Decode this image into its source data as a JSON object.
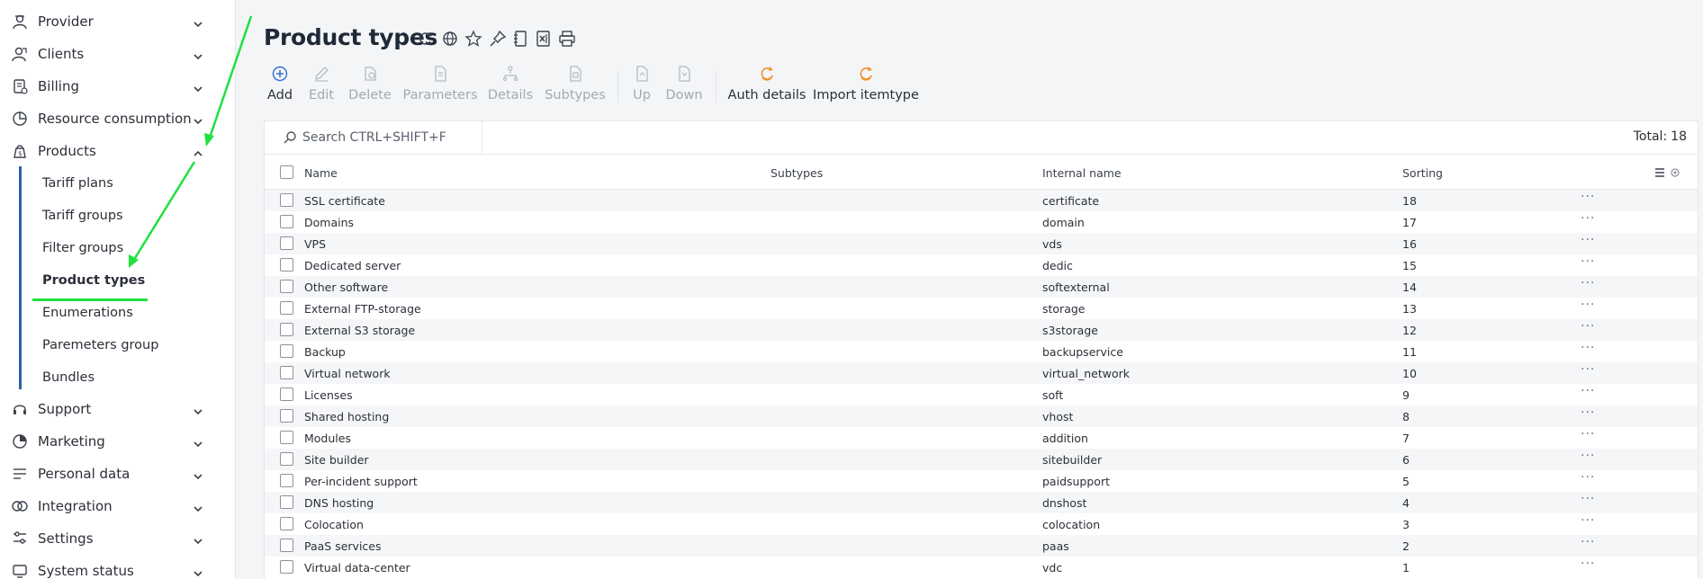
{
  "sidebar": {
    "items": [
      {
        "label": "Provider",
        "icon": "provider-icon",
        "expanded": false
      },
      {
        "label": "Clients",
        "icon": "clients-icon",
        "expanded": false
      },
      {
        "label": "Billing",
        "icon": "billing-icon",
        "expanded": false
      },
      {
        "label": "Resource consumption",
        "icon": "resource-consumption-icon",
        "expanded": false
      },
      {
        "label": "Products",
        "icon": "products-icon",
        "expanded": true
      },
      {
        "label": "Support",
        "icon": "support-icon",
        "expanded": false
      },
      {
        "label": "Marketing",
        "icon": "marketing-icon",
        "expanded": false
      },
      {
        "label": "Personal data",
        "icon": "personal-data-icon",
        "expanded": false
      },
      {
        "label": "Integration",
        "icon": "integration-icon",
        "expanded": false
      },
      {
        "label": "Settings",
        "icon": "settings-icon",
        "expanded": false
      },
      {
        "label": "System status",
        "icon": "system-status-icon",
        "expanded": false
      }
    ],
    "products_subitems": [
      {
        "label": "Tariff plans",
        "active": false
      },
      {
        "label": "Tariff groups",
        "active": false
      },
      {
        "label": "Filter groups",
        "active": false
      },
      {
        "label": "Product types",
        "active": true
      },
      {
        "label": "Enumerations",
        "active": false
      },
      {
        "label": "Paremeters group",
        "active": false
      },
      {
        "label": "Bundles",
        "active": false
      }
    ]
  },
  "page": {
    "title": "Product types",
    "title_icons": [
      "refresh-icon",
      "globe-icon",
      "star-icon",
      "pin-icon",
      "notebook-icon",
      "excel-export-icon",
      "print-icon"
    ]
  },
  "toolbar": {
    "buttons": [
      {
        "label": "Add",
        "icon": "add-icon",
        "enabled": true
      },
      {
        "label": "Edit",
        "icon": "edit-icon",
        "enabled": false
      },
      {
        "label": "Delete",
        "icon": "delete-icon",
        "enabled": false
      },
      {
        "label": "Parameters",
        "icon": "parameters-icon",
        "enabled": false
      },
      {
        "label": "Details",
        "icon": "details-icon",
        "enabled": false
      },
      {
        "label": "Subtypes",
        "icon": "subtypes-icon",
        "enabled": false
      },
      {
        "label": "Up",
        "icon": "up-icon",
        "enabled": false
      },
      {
        "label": "Down",
        "icon": "down-icon",
        "enabled": false
      },
      {
        "label": "Auth details",
        "icon": "auth-details-icon",
        "enabled": true
      },
      {
        "label": "Import itemtype",
        "icon": "import-itemtype-icon",
        "enabled": true
      }
    ]
  },
  "search": {
    "placeholder": "Search CTRL+SHIFT+F",
    "value": ""
  },
  "total": {
    "label": "Total:",
    "value": "18"
  },
  "table": {
    "columns": [
      "Name",
      "Subtypes",
      "Internal name",
      "Sorting"
    ],
    "rows": [
      {
        "name": "SSL certificate",
        "subtypes": "",
        "internal": "certificate",
        "sorting": "18"
      },
      {
        "name": "Domains",
        "subtypes": "",
        "internal": "domain",
        "sorting": "17"
      },
      {
        "name": "VPS",
        "subtypes": "",
        "internal": "vds",
        "sorting": "16"
      },
      {
        "name": "Dedicated server",
        "subtypes": "",
        "internal": "dedic",
        "sorting": "15"
      },
      {
        "name": "Other software",
        "subtypes": "",
        "internal": "softexternal",
        "sorting": "14"
      },
      {
        "name": "External FTP-storage",
        "subtypes": "",
        "internal": "storage",
        "sorting": "13"
      },
      {
        "name": "External S3 storage",
        "subtypes": "",
        "internal": "s3storage",
        "sorting": "12"
      },
      {
        "name": "Backup",
        "subtypes": "",
        "internal": "backupservice",
        "sorting": "11"
      },
      {
        "name": "Virtual network",
        "subtypes": "",
        "internal": "virtual_network",
        "sorting": "10"
      },
      {
        "name": "Licenses",
        "subtypes": "",
        "internal": "soft",
        "sorting": "9"
      },
      {
        "name": "Shared hosting",
        "subtypes": "",
        "internal": "vhost",
        "sorting": "8"
      },
      {
        "name": "Modules",
        "subtypes": "",
        "internal": "addition",
        "sorting": "7"
      },
      {
        "name": "Site builder",
        "subtypes": "",
        "internal": "sitebuilder",
        "sorting": "6"
      },
      {
        "name": "Per-incident support",
        "subtypes": "",
        "internal": "paidsupport",
        "sorting": "5"
      },
      {
        "name": "DNS hosting",
        "subtypes": "",
        "internal": "dnshost",
        "sorting": "4"
      },
      {
        "name": "Colocation",
        "subtypes": "",
        "internal": "colocation",
        "sorting": "3"
      },
      {
        "name": "PaaS services",
        "subtypes": "",
        "internal": "paas",
        "sorting": "2"
      },
      {
        "name": "Virtual data-center",
        "subtypes": "",
        "internal": "vdc",
        "sorting": "1"
      }
    ]
  },
  "colors": {
    "accent_blue": "#2d6fd3",
    "warning_orange": "#f0932b",
    "annotation_green": "#20e040",
    "nav_line": "#2d5fa8"
  }
}
